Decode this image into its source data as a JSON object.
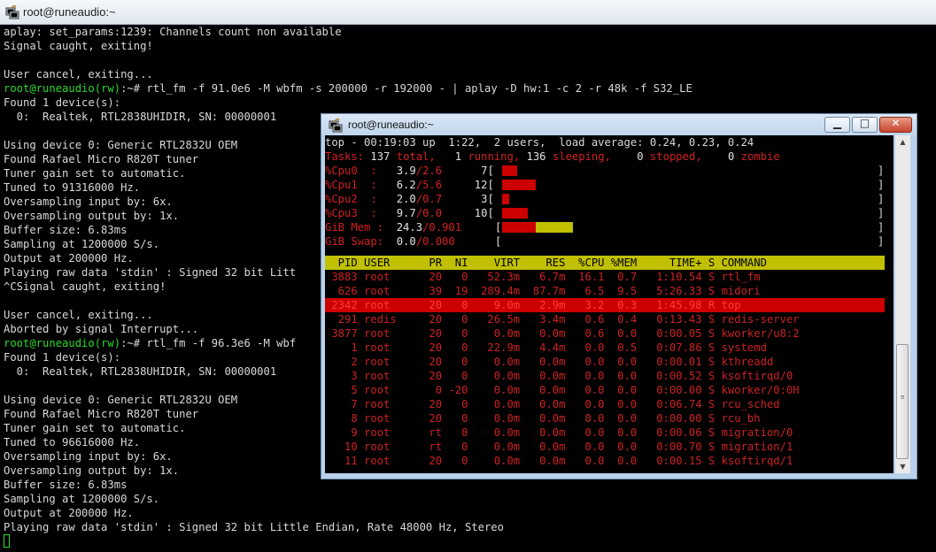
{
  "main_window": {
    "title": "root@runeaudio:~",
    "lines": [
      "aplay: set_params:1239: Channels count non available",
      "Signal caught, exiting!",
      "",
      "User cancel, exiting...",
      {
        "prompt": "root@runeaudio(rw)",
        "rest": ":~# rtl_fm -f 91.0e6 -M wbfm -s 200000 -r 192000 - | aplay -D hw:1 -c 2 -r 48k -f S32_LE"
      },
      "Found 1 device(s):",
      "  0:  Realtek, RTL2838UHIDIR, SN: 00000001",
      "",
      "Using device 0: Generic RTL2832U OEM",
      "Found Rafael Micro R820T tuner",
      "Tuner gain set to automatic.",
      "Tuned to 91316000 Hz.",
      "Oversampling input by: 6x.",
      "Oversampling output by: 1x.",
      "Buffer size: 6.83ms",
      "Sampling at 1200000 S/s.",
      "Output at 200000 Hz.",
      "Playing raw data 'stdin' : Signed 32 bit Litt",
      "^CSignal caught, exiting!",
      "",
      "User cancel, exiting...",
      "Aborted by signal Interrupt...",
      {
        "prompt": "root@runeaudio(rw)",
        "rest": ":~# rtl_fm -f 96.3e6 -M wbf"
      },
      "Found 1 device(s):",
      "  0:  Realtek, RTL2838UHIDIR, SN: 00000001",
      "",
      "Using device 0: Generic RTL2832U OEM",
      "Found Rafael Micro R820T tuner",
      "Tuner gain set to automatic.",
      "Tuned to 96616000 Hz.",
      "Oversampling input by: 6x.",
      "Oversampling output by: 1x.",
      "Buffer size: 6.83ms",
      "Sampling at 1200000 S/s.",
      "Output at 200000 Hz.",
      "Playing raw data 'stdin' : Signed 32 bit Little Endian, Rate 48000 Hz, Stereo"
    ]
  },
  "top_window": {
    "title": "root@runeaudio:~",
    "buttons": {
      "minimize": "▁",
      "maximize": "□",
      "close": "✕"
    },
    "summary": {
      "line1": "top - 00:19:03 up  1:22,  2 users,  load average: 0.24, 0.23, 0.24",
      "tasks_label": "Tasks:",
      "tasks_total": " 137",
      "total_label": " total,",
      "running": "   1",
      "running_label": " running,",
      "sleeping": " 136",
      "sleeping_label": " sleeping,",
      "stopped": "    0",
      "stopped_label": " stopped,",
      "zombie": "    0",
      "zombie_label": " zombie"
    },
    "cpus": [
      {
        "label": "%Cpu0  :",
        "us": "   3.9",
        "sy": "/2.6",
        "count": "      7",
        "fill": 0.04
      },
      {
        "label": "%Cpu1  :",
        "us": "   6.2",
        "sy": "/5.6",
        "count": "     12",
        "fill": 0.09
      },
      {
        "label": "%Cpu2  :",
        "us": "   2.0",
        "sy": "/0.7",
        "count": "      3",
        "fill": 0.02
      },
      {
        "label": "%Cpu3  :",
        "us": "   9.7",
        "sy": "/0.0",
        "count": "     10",
        "fill": 0.07
      }
    ],
    "mem": {
      "label": "GiB Mem :",
      "used": "  24.3",
      "total": "/0.901",
      "fill_red": 0.09,
      "fill_yellow": 0.1
    },
    "swap": {
      "label": "GiB Swap:",
      "used": "  0.0",
      "total": "/0.000"
    },
    "columns": "  PID USER      PR  NI    VIRT    RES  %CPU %MEM     TIME+ S COMMAND",
    "processes": [
      " 3883 root      20   0   52.3m   6.7m  16.1  0.7   1:10.54 S rtl_fm",
      "  626 root      39  19  289.4m  87.7m   6.5  9.5   5:26.33 S midori",
      " 2342 root      20   0    9.0m   2.9m   3.2  0.3   1:45.98 R top",
      "  291 redis     20   0   26.5m   3.4m   0.6  0.4   0:13.43 S redis-server",
      " 3877 root      20   0    0.0m   0.0m   0.6  0.0   0:00.05 S kworker/u8:2",
      "    1 root      20   0   22.9m   4.4m   0.0  0.5   0:07.86 S systemd",
      "    2 root      20   0    0.0m   0.0m   0.0  0.0   0:00.01 S kthreadd",
      "    3 root      20   0    0.0m   0.0m   0.0  0.0   0:00.52 S ksoftirqd/0",
      "    5 root       0 -20    0.0m   0.0m   0.0  0.0   0:00.00 S kworker/0:0H",
      "    7 root      20   0    0.0m   0.0m   0.0  0.0   0:06.74 S rcu_sched",
      "    8 root      20   0    0.0m   0.0m   0.0  0.0   0:00.00 S rcu_bh",
      "    9 root      rt   0    0.0m   0.0m   0.0  0.0   0:00.06 S migration/0",
      "   10 root      rt   0    0.0m   0.0m   0.0  0.0   0:00.70 S migration/1",
      "   11 root      20   0    0.0m   0.0m   0.0  0.0   0:00.15 S ksoftirqd/1"
    ],
    "selected_index": 2
  },
  "colors": {
    "prompt": "#2bd92b",
    "top_red": "#d32020",
    "header_bg": "#c0c000",
    "selected_bg": "#cc0000"
  }
}
